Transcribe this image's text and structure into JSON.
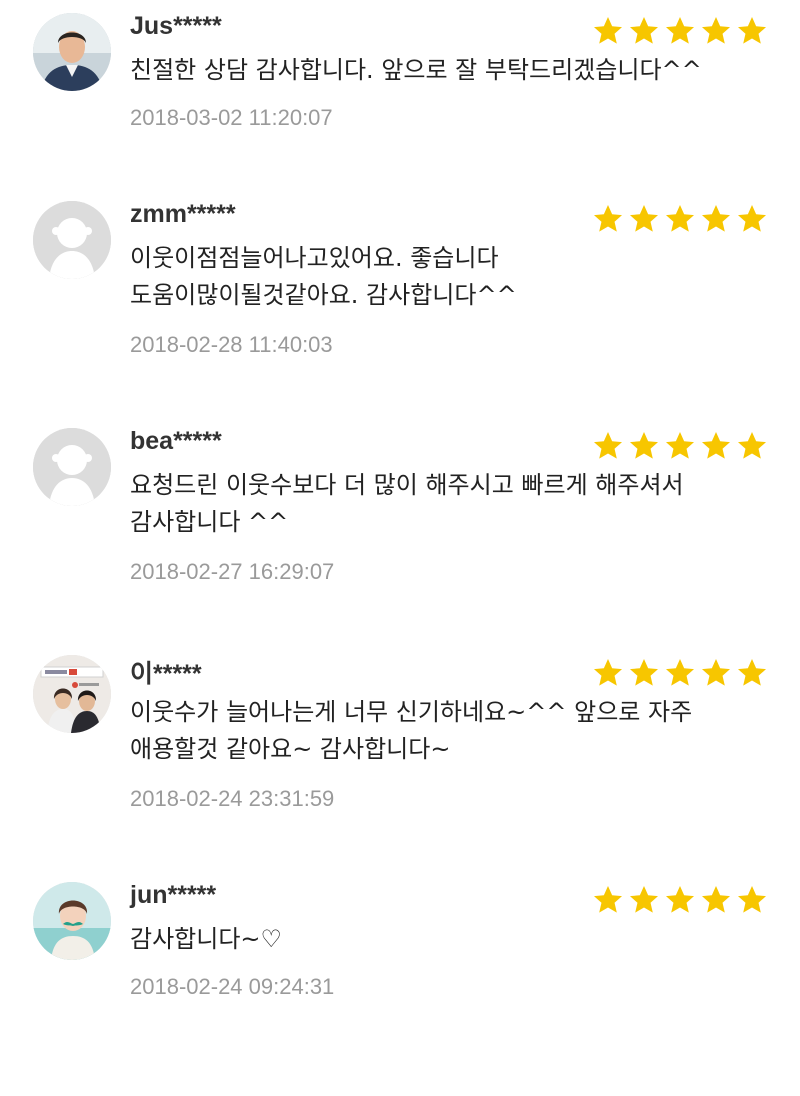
{
  "colors": {
    "star": "#f7c600",
    "username": "#333333",
    "text": "#222222",
    "date": "#9a9a9a",
    "default_avatar_bg": "#dcdcdc"
  },
  "reviews": [
    {
      "username": "Jus*****",
      "rating": 5,
      "avatar": "user-photo-avatar",
      "lines": [
        "친절한 상담 감사합니다. 앞으로 잘 부탁드리겠습니다^^"
      ],
      "date": "2018-03-02 11:20:07"
    },
    {
      "username": "zmm*****",
      "rating": 5,
      "avatar": "default-avatar",
      "lines": [
        "이웃이점점늘어나고있어요. 좋습니다",
        "도움이많이될것같아요. 감사합니다^^"
      ],
      "date": "2018-02-28 11:40:03"
    },
    {
      "username": "bea*****",
      "rating": 5,
      "avatar": "default-avatar",
      "lines": [
        "요청드린 이웃수보다 더 많이 해주시고 빠르게 해주셔서",
        "감사합니다 ^^"
      ],
      "date": "2018-02-27 16:29:07"
    },
    {
      "username": "이*****",
      "rating": 5,
      "avatar": "user-photo-avatar",
      "lines": [
        "이웃수가 늘어나는게 너무 신기하네요~^^ 앞으로 자주",
        "애용할것 같아요~ 감사합니다~"
      ],
      "date": "2018-02-24 23:31:59"
    },
    {
      "username": "jun*****",
      "rating": 5,
      "avatar": "user-photo-avatar",
      "lines": [
        "감사합니다~♡"
      ],
      "date": "2018-02-24 09:24:31"
    }
  ]
}
